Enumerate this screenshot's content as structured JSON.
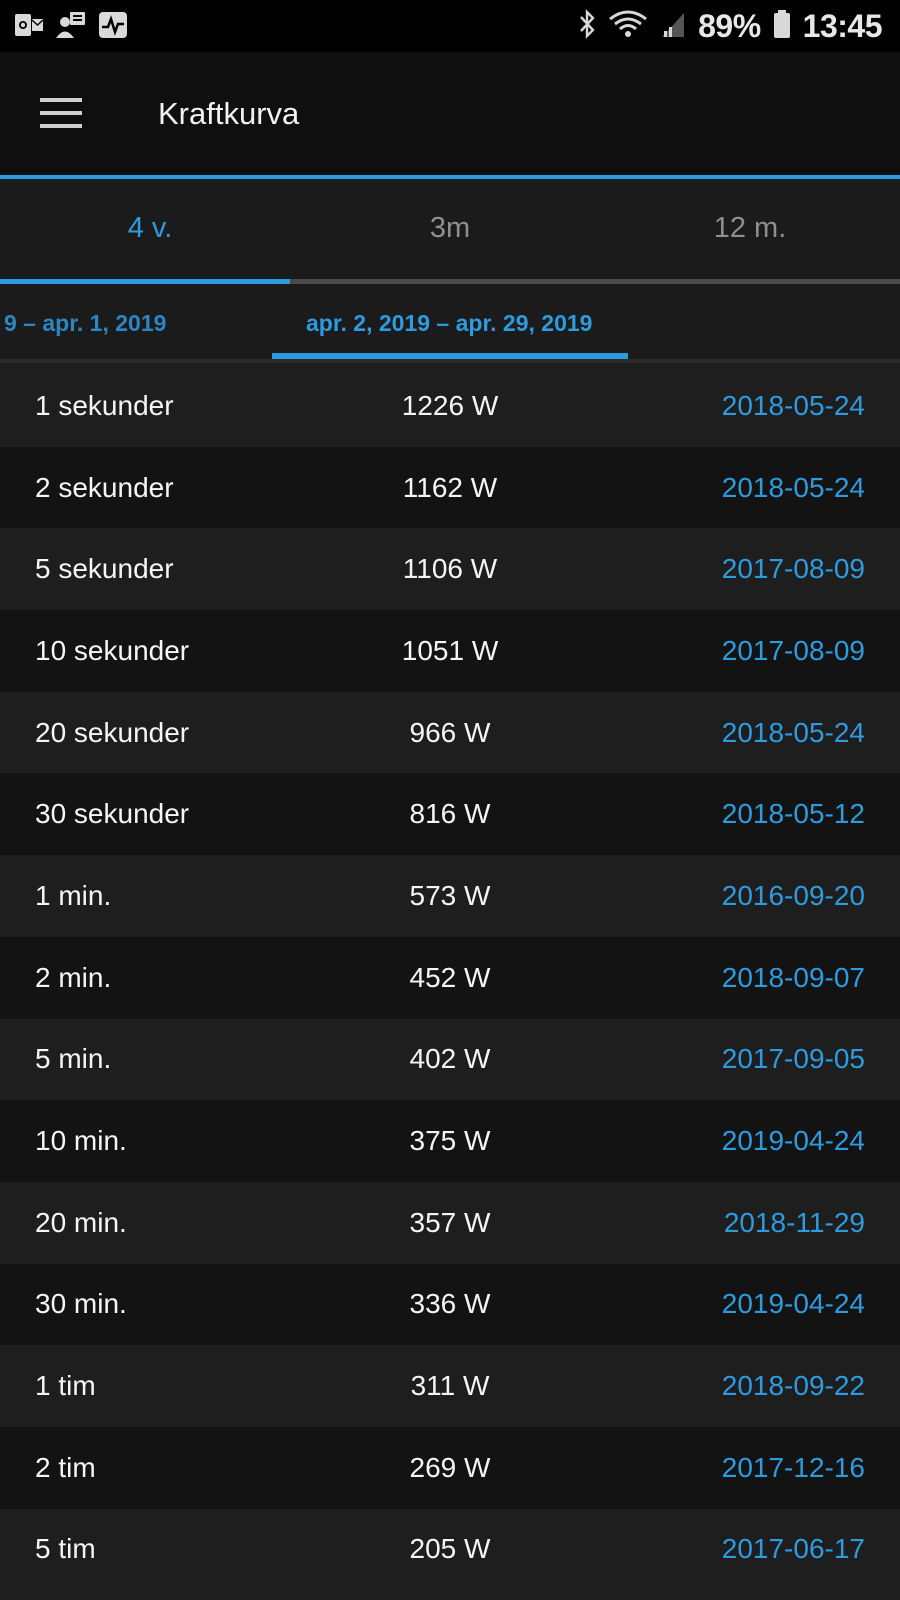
{
  "status_bar": {
    "battery": "89%",
    "time": "13:45",
    "icons": [
      "outlook-icon",
      "contact-card-icon",
      "activity-icon",
      "bluetooth-icon",
      "wifi-icon",
      "signal-icon",
      "battery-icon"
    ]
  },
  "app_bar": {
    "title": "Kraftkurva",
    "menu_icon": "hamburger-menu-icon"
  },
  "period_tabs": [
    {
      "label": "4 v.",
      "active": true
    },
    {
      "label": "3m",
      "active": false
    },
    {
      "label": "12 m.",
      "active": false
    }
  ],
  "range_tabs": {
    "previous": "9 – apr. 1, 2019",
    "current": "apr. 2, 2019 – apr. 29, 2019"
  },
  "records": [
    {
      "duration": "1 sekunder",
      "power": "1226 W",
      "date": "2018-05-24"
    },
    {
      "duration": "2 sekunder",
      "power": "1162 W",
      "date": "2018-05-24"
    },
    {
      "duration": "5 sekunder",
      "power": "1106 W",
      "date": "2017-08-09"
    },
    {
      "duration": "10 sekunder",
      "power": "1051 W",
      "date": "2017-08-09"
    },
    {
      "duration": "20 sekunder",
      "power": "966 W",
      "date": "2018-05-24"
    },
    {
      "duration": "30 sekunder",
      "power": "816 W",
      "date": "2018-05-12"
    },
    {
      "duration": "1 min.",
      "power": "573 W",
      "date": "2016-09-20"
    },
    {
      "duration": "2 min.",
      "power": "452 W",
      "date": "2018-09-07"
    },
    {
      "duration": "5 min.",
      "power": "402 W",
      "date": "2017-09-05"
    },
    {
      "duration": "10 min.",
      "power": "375 W",
      "date": "2019-04-24"
    },
    {
      "duration": "20 min.",
      "power": "357 W",
      "date": "2018-11-29"
    },
    {
      "duration": "30 min.",
      "power": "336 W",
      "date": "2019-04-24"
    },
    {
      "duration": "1 tim",
      "power": "311 W",
      "date": "2018-09-22"
    },
    {
      "duration": "2 tim",
      "power": "269 W",
      "date": "2017-12-16"
    },
    {
      "duration": "5 tim",
      "power": "205 W",
      "date": "2017-06-17"
    }
  ],
  "colors": {
    "accent": "#2d9be0",
    "background": "#1e1e1e",
    "row_alt": "#131313",
    "appbar": "#0f0f0f"
  }
}
